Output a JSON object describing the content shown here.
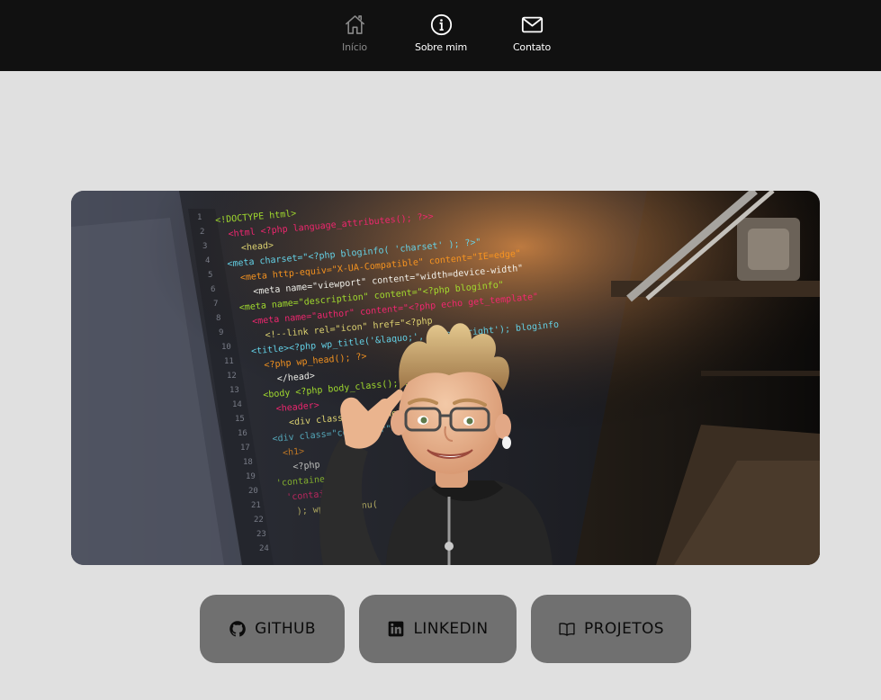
{
  "nav": {
    "items": [
      {
        "label": "Início",
        "icon": "home-icon",
        "active": true
      },
      {
        "label": "Sobre mim",
        "icon": "info-icon"
      },
      {
        "label": "Contato",
        "icon": "mail-icon"
      }
    ]
  },
  "hero": {
    "image": "developer-memoji-in-front-of-code-screen",
    "code_lines": [
      "<!DOCTYPE html>",
      "<html <?php language_attributes(); ?>>",
      "<head>",
      "<meta charset=\"<?php bloginfo( 'charset' ); ?>\"",
      "<meta http-equiv=\"X-UA-Compatible\" content=\"IE=edge\"",
      "<meta name=\"viewport\" content=\"width=device-width\"",
      "<meta name=\"description\" content=\"<?php bloginfo\"",
      "<meta name=\"author\" content=\"<?php echo get_template\"",
      "<!--link rel=\"icon\" href=\"<?php",
      "<title><?php wp_title('&laquo;', true, 'right'); bloginfo",
      "<?php wp_head(); ?>",
      "</head>",
      "<body <?php body_class(); ?>>",
      "<header>",
      "<div class=\"container\">",
      "<div class=\"container\">",
      "<h1>",
      "<?php",
      "'container'",
      "'container",
      "); wp_nav_menu("
    ]
  },
  "buttons": [
    {
      "label": "GITHUB",
      "icon": "github-icon"
    },
    {
      "label": "LINKEDIN",
      "icon": "linkedin-icon"
    },
    {
      "label": "PROJETOS",
      "icon": "book-icon"
    }
  ],
  "colors": {
    "topbar": "#111111",
    "background": "#e0e0e0",
    "button": "#707070",
    "nav_active": "#8a8a8a",
    "nav_text": "#ffffff"
  }
}
